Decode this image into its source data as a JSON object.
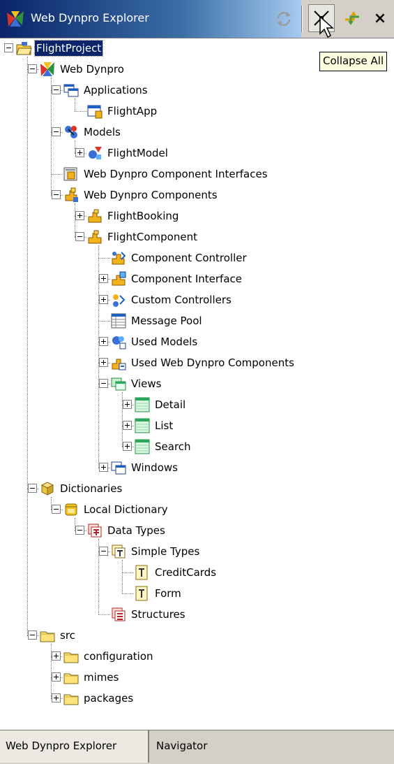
{
  "window": {
    "title": "Web Dynpro Explorer",
    "toolbar": {
      "sync_icon": "sync-icon",
      "collapse_icon": "collapse-all-icon",
      "link_icon": "link-with-editor-icon",
      "close_label": "×"
    },
    "tooltip": "Collapse All"
  },
  "tree": [
    {
      "label": "FlightProject",
      "icon": "project-folder-icon",
      "depth": 0,
      "toggle": "open",
      "selected": true
    },
    {
      "label": "Web Dynpro",
      "icon": "web-dynpro-icon",
      "depth": 1,
      "toggle": "open"
    },
    {
      "label": "Applications",
      "icon": "applications-icon",
      "depth": 2,
      "toggle": "open"
    },
    {
      "label": "FlightApp",
      "icon": "application-icon",
      "depth": 3,
      "toggle": "none"
    },
    {
      "label": "Models",
      "icon": "models-icon",
      "depth": 2,
      "toggle": "open"
    },
    {
      "label": "FlightModel",
      "icon": "model-icon",
      "depth": 3,
      "toggle": "closed"
    },
    {
      "label": "Web Dynpro Component Interfaces",
      "icon": "component-interfaces-icon",
      "depth": 2,
      "toggle": "none"
    },
    {
      "label": "Web Dynpro Components",
      "icon": "components-icon",
      "depth": 2,
      "toggle": "open"
    },
    {
      "label": "FlightBooking",
      "icon": "component-icon",
      "depth": 3,
      "toggle": "closed"
    },
    {
      "label": "FlightComponent",
      "icon": "component-icon",
      "depth": 3,
      "toggle": "open"
    },
    {
      "label": "Component Controller",
      "icon": "component-controller-icon",
      "depth": 4,
      "toggle": "none"
    },
    {
      "label": "Component Interface",
      "icon": "component-interface-icon",
      "depth": 4,
      "toggle": "closed"
    },
    {
      "label": "Custom Controllers",
      "icon": "custom-controllers-icon",
      "depth": 4,
      "toggle": "closed"
    },
    {
      "label": "Message Pool",
      "icon": "message-pool-icon",
      "depth": 4,
      "toggle": "none"
    },
    {
      "label": "Used Models",
      "icon": "used-models-icon",
      "depth": 4,
      "toggle": "closed"
    },
    {
      "label": "Used Web Dynpro Components",
      "icon": "used-components-icon",
      "depth": 4,
      "toggle": "closed"
    },
    {
      "label": "Views",
      "icon": "views-icon",
      "depth": 4,
      "toggle": "open"
    },
    {
      "label": "Detail",
      "icon": "view-icon",
      "depth": 5,
      "toggle": "closed"
    },
    {
      "label": "List",
      "icon": "view-icon",
      "depth": 5,
      "toggle": "closed"
    },
    {
      "label": "Search",
      "icon": "view-icon",
      "depth": 5,
      "toggle": "closed"
    },
    {
      "label": "Windows",
      "icon": "windows-icon",
      "depth": 4,
      "toggle": "closed"
    },
    {
      "label": "Dictionaries",
      "icon": "dictionaries-icon",
      "depth": 1,
      "toggle": "open"
    },
    {
      "label": "Local Dictionary",
      "icon": "local-dictionary-icon",
      "depth": 2,
      "toggle": "open"
    },
    {
      "label": "Data Types",
      "icon": "data-types-icon",
      "depth": 3,
      "toggle": "open"
    },
    {
      "label": "Simple Types",
      "icon": "simple-types-icon",
      "depth": 4,
      "toggle": "open"
    },
    {
      "label": "CreditCards",
      "icon": "simple-type-icon",
      "depth": 5,
      "toggle": "none"
    },
    {
      "label": "Form",
      "icon": "simple-type-icon",
      "depth": 5,
      "toggle": "none"
    },
    {
      "label": "Structures",
      "icon": "structures-icon",
      "depth": 4,
      "toggle": "none"
    },
    {
      "label": "src",
      "icon": "folder-icon",
      "depth": 1,
      "toggle": "open"
    },
    {
      "label": "configuration",
      "icon": "folder-icon",
      "depth": 2,
      "toggle": "closed"
    },
    {
      "label": "mimes",
      "icon": "folder-icon",
      "depth": 2,
      "toggle": "closed"
    },
    {
      "label": "packages",
      "icon": "folder-icon",
      "depth": 2,
      "toggle": "closed"
    }
  ],
  "tabs": [
    {
      "label": "Web Dynpro Explorer",
      "active": true
    },
    {
      "label": "Navigator",
      "active": false
    }
  ],
  "colors": {
    "selection": "#0a246a",
    "title_gradient_start": "#0a246a",
    "title_gradient_end": "#a6caf0",
    "tooltip_bg": "#ffffe1",
    "chrome": "#d4d0c8"
  }
}
